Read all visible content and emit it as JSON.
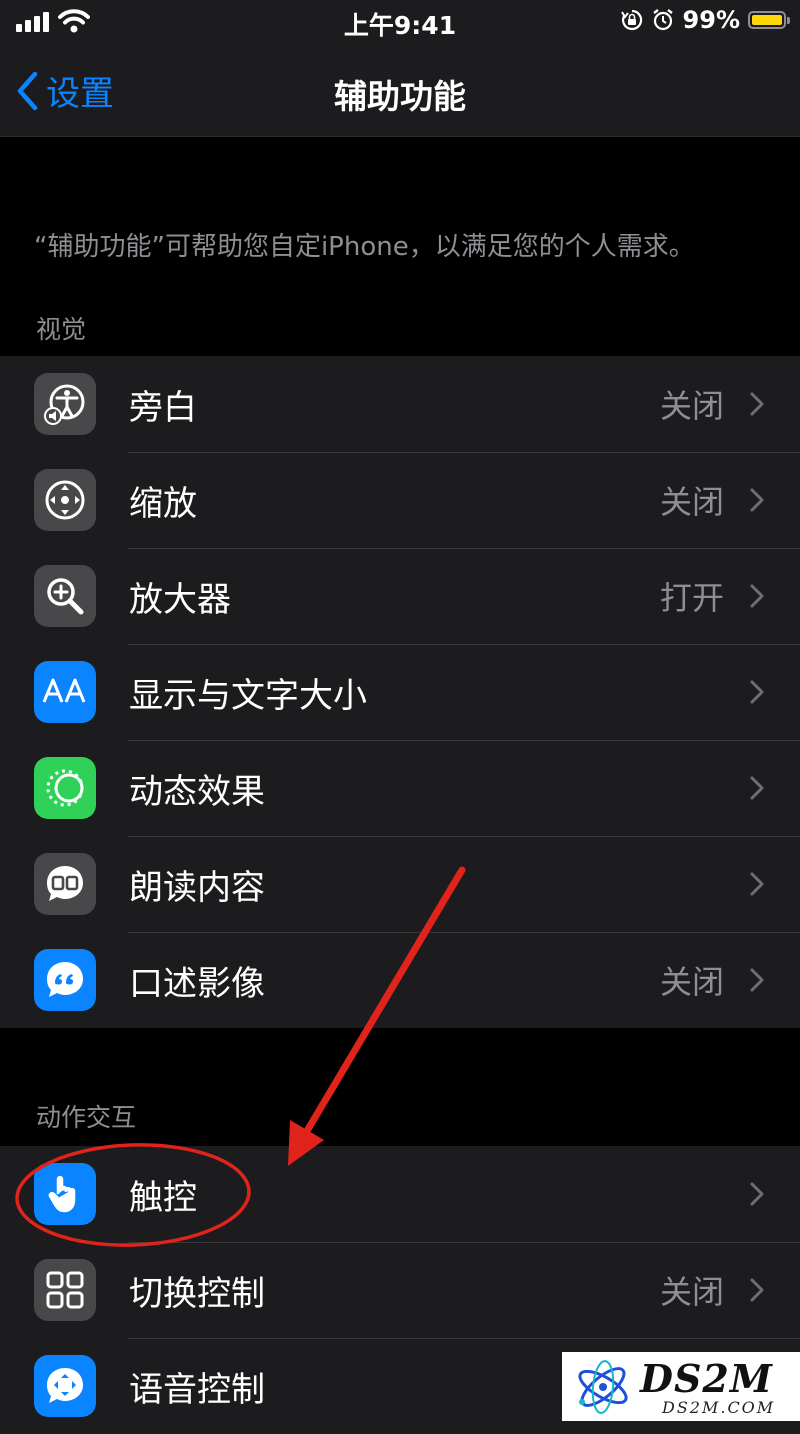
{
  "status_bar": {
    "time": "上午9:41",
    "battery_percent": "99%",
    "battery_color": "#ffd60a",
    "icons": [
      "signal-icon",
      "wifi-icon",
      "orientation-lock-icon",
      "alarm-icon",
      "battery-icon"
    ]
  },
  "nav": {
    "back_label": "设置",
    "title": "辅助功能",
    "accent": "#0a84ff"
  },
  "description": "“辅助功能”可帮助您自定iPhone，以满足您的个人需求。",
  "sections": {
    "vision": {
      "header": "视觉",
      "items": [
        {
          "label": "旁白",
          "value": "关闭",
          "icon": "voiceover-icon",
          "icon_color": "#48484a"
        },
        {
          "label": "缩放",
          "value": "关闭",
          "icon": "zoom-icon",
          "icon_color": "#48484a"
        },
        {
          "label": "放大器",
          "value": "打开",
          "icon": "magnifier-icon",
          "icon_color": "#48484a"
        },
        {
          "label": "显示与文字大小",
          "value": "",
          "icon": "text-size-icon",
          "icon_color": "#0a84ff"
        },
        {
          "label": "动态效果",
          "value": "",
          "icon": "motion-icon",
          "icon_color": "#30d158"
        },
        {
          "label": "朗读内容",
          "value": "",
          "icon": "spoken-content-icon",
          "icon_color": "#48484a"
        },
        {
          "label": "口述影像",
          "value": "关闭",
          "icon": "audio-descriptions-icon",
          "icon_color": "#0a84ff"
        }
      ]
    },
    "interaction": {
      "header": "动作交互",
      "items": [
        {
          "label": "触控",
          "value": "",
          "icon": "touch-icon",
          "icon_color": "#0a84ff"
        },
        {
          "label": "切换控制",
          "value": "关闭",
          "icon": "switch-control-icon",
          "icon_color": "#48484a"
        },
        {
          "label": "语音控制",
          "value": "",
          "icon": "voice-control-icon",
          "icon_color": "#0a84ff"
        }
      ]
    }
  },
  "annotation_color": "#e0241c",
  "watermark": {
    "brand": "DS2M",
    "site": "DS2M.COM"
  }
}
